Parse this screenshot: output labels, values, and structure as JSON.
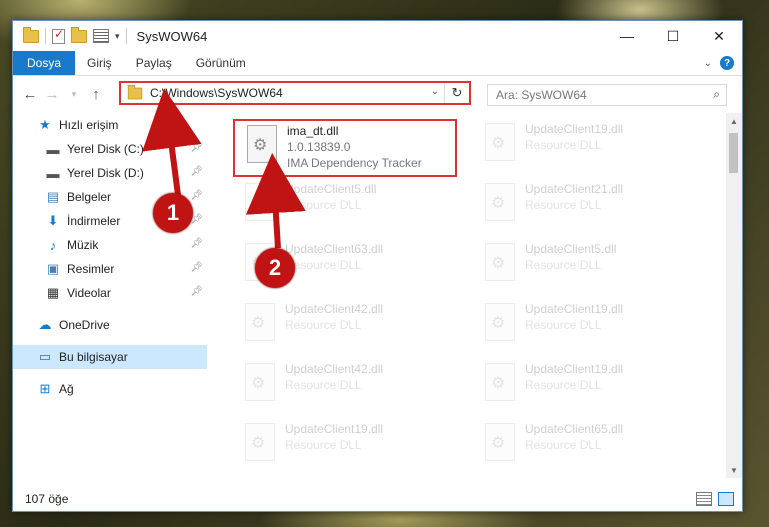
{
  "window": {
    "title": "SysWOW64"
  },
  "titlebar": {
    "minimize": "—",
    "maximize": "☐",
    "close": "✕"
  },
  "ribbon": {
    "tabs": [
      "Dosya",
      "Giriş",
      "Paylaş",
      "Görünüm"
    ]
  },
  "address": {
    "path": "C:\\Windows\\SysWOW64"
  },
  "search": {
    "placeholder": "Ara: SysWOW64"
  },
  "sidebar": {
    "items": [
      {
        "label": "Hızlı erişim",
        "icon": "star-icon"
      },
      {
        "label": "Yerel Disk (C:)",
        "icon": "drive-icon",
        "pinned": true
      },
      {
        "label": "Yerel Disk (D:)",
        "icon": "drive-icon",
        "pinned": true
      },
      {
        "label": "Belgeler",
        "icon": "documents-icon",
        "pinned": true
      },
      {
        "label": "İndirmeler",
        "icon": "download-icon",
        "pinned": true
      },
      {
        "label": "Müzik",
        "icon": "music-icon",
        "pinned": true
      },
      {
        "label": "Resimler",
        "icon": "pictures-icon",
        "pinned": true
      },
      {
        "label": "Videolar",
        "icon": "videos-icon",
        "pinned": true
      },
      {
        "label": "OneDrive",
        "icon": "cloud-icon"
      },
      {
        "label": "Bu bilgisayar",
        "icon": "computer-icon",
        "selected": true
      },
      {
        "label": "Ağ",
        "icon": "network-icon"
      }
    ]
  },
  "files": [
    {
      "name": "ima_dt.dll",
      "version": "1.0.13839.0",
      "desc": "IMA Dependency Tracker",
      "selected": true
    },
    {
      "name": "UpdateClient19.dll",
      "desc": "Resource DLL"
    },
    {
      "name": "UpdateClient5.dll",
      "desc": "Resource DLL"
    },
    {
      "name": "UpdateClient21.dll",
      "desc": "Resource DLL"
    },
    {
      "name": "UpdateClient63.dll",
      "desc": "Resource DLL"
    },
    {
      "name": "UpdateClient5.dll",
      "desc": "Resource DLL"
    },
    {
      "name": "UpdateClient42.dll",
      "desc": "Resource DLL"
    },
    {
      "name": "UpdateClient19.dll",
      "desc": "Resource DLL"
    },
    {
      "name": "UpdateClient42.dll",
      "desc": "Resource DLL"
    },
    {
      "name": "UpdateClient19.dll",
      "desc": "Resource DLL"
    },
    {
      "name": "UpdateClient19.dll",
      "desc": "Resource DLL"
    },
    {
      "name": "UpdateClient65.dll",
      "desc": "Resource DLL"
    }
  ],
  "status": {
    "count": "107 öğe"
  },
  "callouts": [
    "1",
    "2"
  ],
  "colors": {
    "accent": "#1979ca",
    "highlight": "#dd3333",
    "callout": "#c01414",
    "selection": "#cce8ff"
  }
}
